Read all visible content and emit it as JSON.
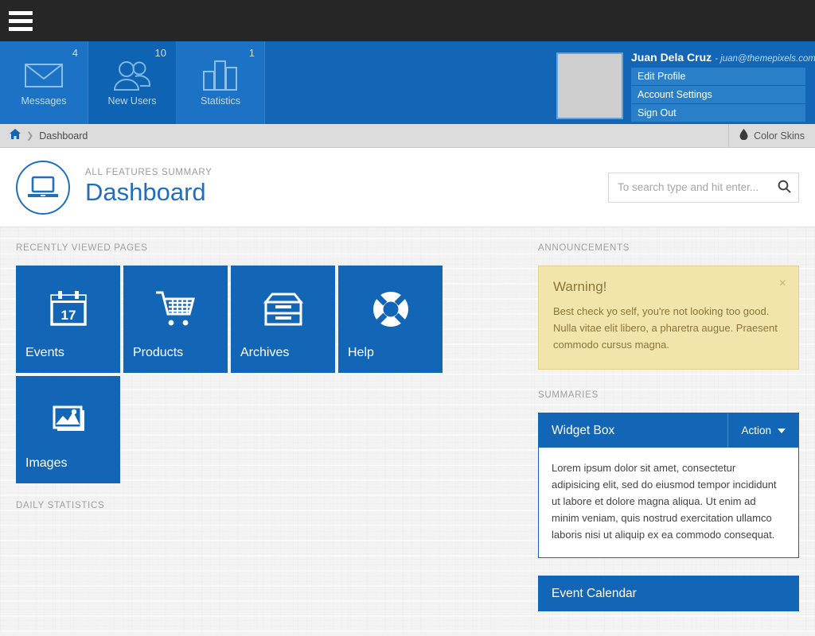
{
  "topbar": {
    "menu_icon": "hamburger-menu-icon"
  },
  "stats": [
    {
      "label": "Messages",
      "count": "4",
      "icon": "envelope-icon"
    },
    {
      "label": "New Users",
      "count": "10",
      "icon": "users-icon"
    },
    {
      "label": "Statistics",
      "count": "1",
      "icon": "bar-chart-icon"
    }
  ],
  "user": {
    "name": "Juan Dela Cruz",
    "email": "- juan@themepixels.com",
    "menu": [
      "Edit Profile",
      "Account Settings",
      "Sign Out"
    ]
  },
  "breadcrumb": {
    "home_icon": "home-icon",
    "separator": "❯",
    "current": "Dashboard"
  },
  "skins": {
    "label": "Color Skins",
    "icon": "droplet-icon"
  },
  "pagehead": {
    "icon": "laptop-icon",
    "kicker": "All Features Summary",
    "title": "Dashboard"
  },
  "search": {
    "value": "",
    "placeholder": "To search type and hit enter...",
    "icon": "search-icon"
  },
  "recent": {
    "label": "Recently Viewed Pages",
    "tiles": [
      {
        "label": "Events",
        "icon": "calendar-icon",
        "day": "17"
      },
      {
        "label": "Products",
        "icon": "shopping-cart-icon"
      },
      {
        "label": "Archives",
        "icon": "archive-icon"
      },
      {
        "label": "Help",
        "icon": "lifebuoy-icon"
      },
      {
        "label": "Images",
        "icon": "photos-icon"
      }
    ]
  },
  "daily_statistics": {
    "label": "Daily Statistics"
  },
  "announcements": {
    "label": "Announcements",
    "alert": {
      "title": "Warning!",
      "body": "Best check yo self, you're not looking too good. Nulla vitae elit libero, a pharetra augue. Praesent commodo cursus magna.",
      "close_icon": "close-icon"
    }
  },
  "summaries": {
    "label": "Summaries",
    "widget": {
      "title": "Widget Box",
      "action": "Action",
      "caret_icon": "chevron-down-icon",
      "body": "Lorem ipsum dolor sit amet, consectetur adipisicing elit, sed do eiusmod tempor incididunt ut labore et dolore magna aliqua. Ut enim ad minim veniam, quis nostrud exercitation ullamco laboris nisi ut aliquip ex ea commodo consequat."
    },
    "calendar": {
      "title": "Event Calendar"
    }
  },
  "colors": {
    "brand": "#1266b5",
    "dark": "#262626",
    "warning_bg": "#f2e5ab",
    "warning_text": "#8a7638"
  }
}
